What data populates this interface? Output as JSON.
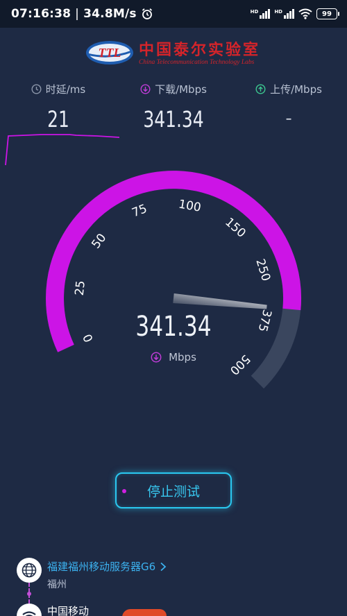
{
  "status_bar": {
    "time": "07:16:38",
    "speed": "34.8M/s",
    "sim1": "HD",
    "sim2": "HD",
    "battery": "99"
  },
  "logo": {
    "mark": "TTL",
    "cn_name": "中国泰尔实验室",
    "en_name": "China Telecommunication Technology Labs",
    "brand_color": "#d4242a"
  },
  "metrics": {
    "latency": {
      "label": "时延/ms",
      "value": "21",
      "icon": "clock-icon"
    },
    "download": {
      "label": "下载/Mbps",
      "value": "341.34",
      "icon": "download-icon"
    },
    "upload": {
      "label": "上传/Mbps",
      "value": "–",
      "icon": "upload-icon"
    }
  },
  "gauge": {
    "value": "341.34",
    "unit": "Mbps",
    "current": 341.34,
    "max": 500,
    "ticks": [
      "0",
      "25",
      "50",
      "75",
      "100",
      "150",
      "250",
      "375",
      "500"
    ],
    "active_color": "#cc14e6",
    "track_color": "#3a465e"
  },
  "actions": {
    "stop_label": "停止测试",
    "accent": "#2ac8f0"
  },
  "server": {
    "name": "福建福州移动服务器G6",
    "city": "福州"
  },
  "isp": {
    "name": "中国移动"
  }
}
